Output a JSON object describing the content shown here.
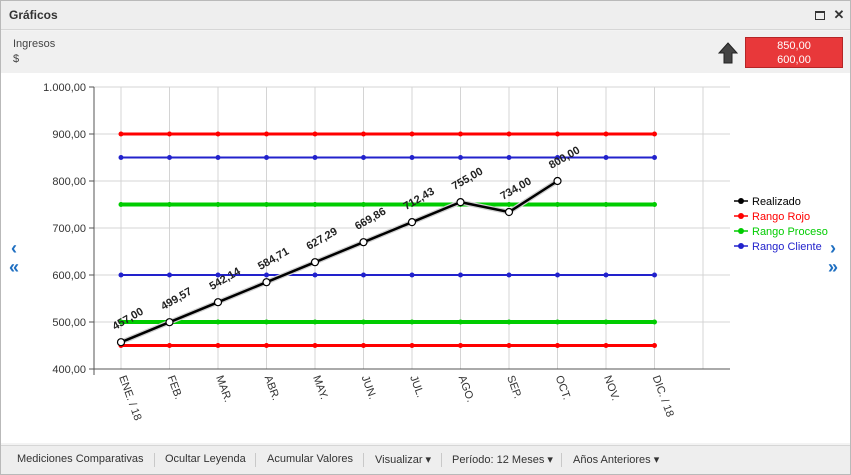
{
  "window": {
    "title": "Gráficos"
  },
  "header": {
    "indicator_name": "Ingresos",
    "unit": "$",
    "range_high": "850,00",
    "range_low": "600,00"
  },
  "toolbar": {
    "comparativas": "Mediciones Comparativas",
    "ocultar": "Ocultar Leyenda",
    "acumular": "Acumular Valores",
    "visualizar": "Visualizar ▾",
    "periodo": "Período: 12 Meses ▾",
    "anios": "Años Anteriores ▾"
  },
  "colors": {
    "realizado": "#000000",
    "rojo": "#ff0000",
    "proceso": "#00cc00",
    "cliente": "#2222cc",
    "grid": "#d4d4d4",
    "accent": "#e8383a"
  },
  "chart_data": {
    "type": "line",
    "categories": [
      "ENE. / 18",
      "FEB.",
      "MAR.",
      "ABR.",
      "MAY.",
      "JUN.",
      "JUL.",
      "AGO.",
      "SEP.",
      "OCT.",
      "NOV.",
      "DIC. / 18"
    ],
    "ylim": [
      400,
      1000
    ],
    "yticks": [
      "400,00",
      "500,00",
      "600,00",
      "700,00",
      "800,00",
      "900,00",
      "1.000,00"
    ],
    "grid": true,
    "legend": "right",
    "series": [
      {
        "name": "Realizado",
        "color": "#000000",
        "values": [
          457.0,
          499.57,
          542.14,
          584.71,
          627.29,
          669.86,
          712.43,
          755.0,
          734.0,
          800.0,
          null,
          null
        ],
        "labels": [
          "457,00",
          "499,57",
          "542,14",
          "584,71",
          "627,29",
          "669,86",
          "712,43",
          "755,00",
          "734,00",
          "800,00"
        ]
      },
      {
        "name": "Rango Rojo",
        "color": "#ff0000",
        "band": [
          450,
          900
        ]
      },
      {
        "name": "Rango Proceso",
        "color": "#00cc00",
        "band": [
          500,
          750
        ]
      },
      {
        "name": "Rango Cliente",
        "color": "#2222cc",
        "band": [
          600,
          850
        ]
      }
    ]
  }
}
